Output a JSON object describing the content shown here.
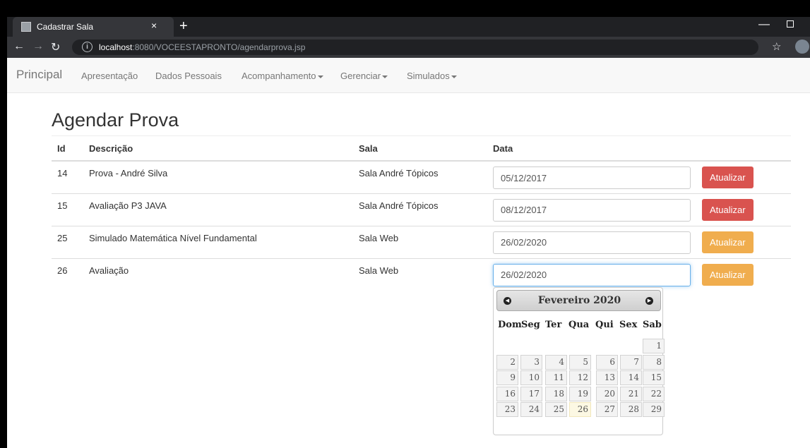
{
  "browser": {
    "tab_title": "Cadastrar Sala",
    "tab_close": "×",
    "new_tab": "+",
    "url_host": "localhost",
    "url_rest": ":8080/VOCEESTAPRONTO/agendarprova.jsp"
  },
  "navbar": {
    "brand": "Principal",
    "items": [
      "Apresentação",
      "Dados Pessoais",
      "Acompanhamento",
      "Gerenciar",
      "Simulados"
    ]
  },
  "page": {
    "title": "Agendar Prova",
    "columns": [
      "Id",
      "Descrição",
      "Sala",
      "Data"
    ],
    "button_label": "Atualizar",
    "rows": [
      {
        "id": "14",
        "descricao": "Prova - André Silva",
        "sala": "Sala André Tópicos",
        "data": "05/12/2017",
        "button_color": "#d9534f"
      },
      {
        "id": "15",
        "descricao": "Avaliação P3 JAVA",
        "sala": "Sala André Tópicos",
        "data": "08/12/2017",
        "button_color": "#d9534f"
      },
      {
        "id": "25",
        "descricao": "Simulado Matemática Nível Fundamental",
        "sala": "Sala Web",
        "data": "26/02/2020",
        "button_color": "#f0ad4e"
      },
      {
        "id": "26",
        "descricao": "Avaliação",
        "sala": "Sala Web",
        "data": "26/02/2020",
        "button_color": "#f0ad4e"
      }
    ]
  },
  "datepicker": {
    "month_label": "Fevereiro 2020",
    "weekdays": [
      "Dom",
      "Seg",
      "Ter",
      "Qua",
      "Qui",
      "Sex",
      "Sab"
    ],
    "weeks": [
      [
        "",
        "",
        "",
        "",
        "",
        "",
        "1"
      ],
      [
        "2",
        "3",
        "4",
        "5",
        "6",
        "7",
        "8"
      ],
      [
        "9",
        "10",
        "11",
        "12",
        "13",
        "14",
        "15"
      ],
      [
        "16",
        "17",
        "18",
        "19",
        "20",
        "21",
        "22"
      ],
      [
        "23",
        "24",
        "25",
        "26",
        "27",
        "28",
        "29"
      ]
    ],
    "highlighted_day": "26"
  }
}
